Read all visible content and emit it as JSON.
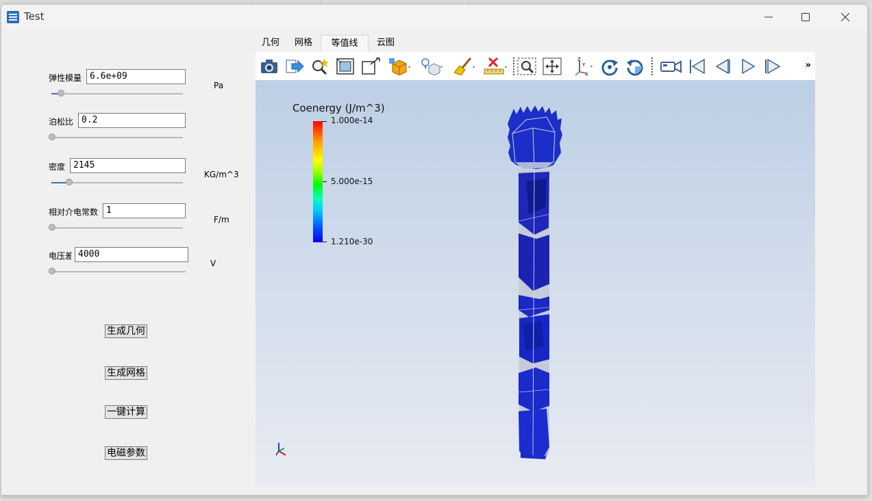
{
  "window": {
    "title": "Test"
  },
  "form": {
    "fields": [
      {
        "label": "弹性模量",
        "value": "6.6e+09",
        "unit": "Pa",
        "slider": 0.1
      },
      {
        "label": "泊松比",
        "value": "0.2",
        "unit": "",
        "slider": 0.0
      },
      {
        "label": "密度",
        "value": "2145",
        "unit": "KG/m^3",
        "slider": 0.13
      },
      {
        "label": "相对介电常数",
        "value": "1",
        "unit": "F/m",
        "slider": 0.0
      },
      {
        "label": "电压差",
        "value": "4000",
        "unit": "V",
        "slider": 0.0
      }
    ]
  },
  "buttons": {
    "generate_geometry": "生成几何",
    "generate_mesh": "生成网格",
    "compute": "一键计算",
    "em_params": "电磁参数"
  },
  "tabs": [
    "几何",
    "网格",
    "等值线",
    "云图"
  ],
  "active_tab": "等值线",
  "toolbar": {
    "icons": [
      "camera-icon",
      "export-icon",
      "zoom-magic-icon",
      "fit-box-icon",
      "box-corner-icon",
      "cube-orange-icon",
      "light-bulb-icon",
      "broom-icon",
      "delete-ruler-icon",
      "zoom-region-icon",
      "pan-icon",
      "axes-icon",
      "rotate-cw-icon",
      "rotate-ccw-icon",
      "camera-video-icon",
      "first-frame-icon",
      "previous-frame-icon",
      "play-icon",
      "last-frame-icon"
    ],
    "more_label": "»"
  },
  "legend": {
    "title": "Coenergy (J/m^3)",
    "max": "1.000e-14",
    "mid": "5.000e-15",
    "min": "1.210e-30",
    "colors": [
      "#ff0000",
      "#ffff00",
      "#00ff00",
      "#00c8ff",
      "#0000ff"
    ]
  }
}
